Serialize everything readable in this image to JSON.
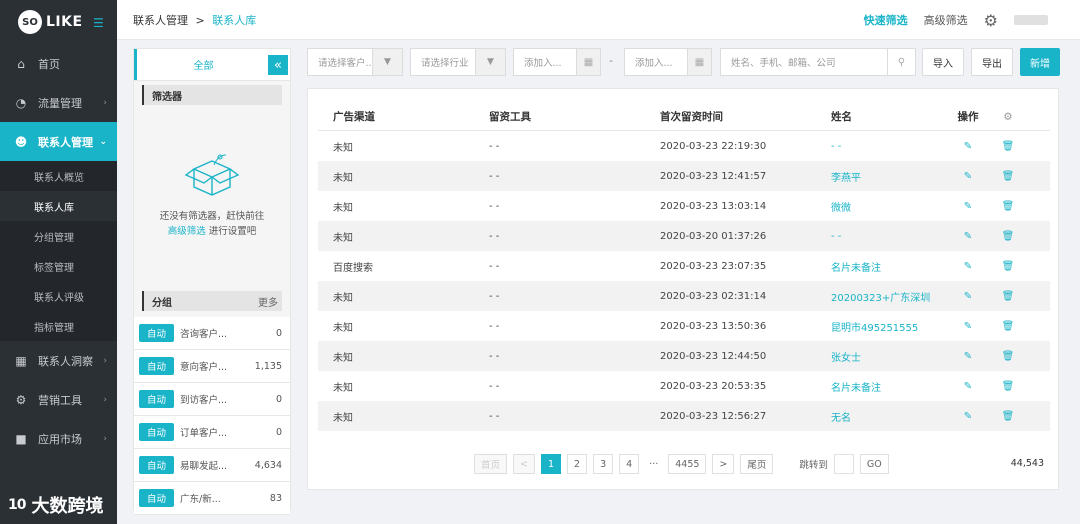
{
  "app": {
    "logo_circle": "SO",
    "logo_text": "LIKE"
  },
  "sidebar": {
    "items": [
      {
        "label": "首页",
        "icon": "home-icon"
      },
      {
        "label": "流量管理",
        "icon": "pie-chart-icon"
      },
      {
        "label": "联系人管理",
        "icon": "users-icon"
      },
      {
        "label": "联系人洞察",
        "icon": "id-card-icon"
      },
      {
        "label": "营销工具",
        "icon": "cogs-icon"
      },
      {
        "label": "应用市场",
        "icon": "briefcase-icon"
      }
    ],
    "sub_items": [
      {
        "label": "联系人概览"
      },
      {
        "label": "联系人库"
      },
      {
        "label": "分组管理"
      },
      {
        "label": "标签管理"
      },
      {
        "label": "联系人评级"
      },
      {
        "label": "指标管理"
      }
    ],
    "watermark": "大数跨境",
    "watermark_logo": "10"
  },
  "header": {
    "breadcrumb_parent": "联系人管理",
    "breadcrumb_sep": ">",
    "breadcrumb_current": "联系人库",
    "quick_filter": "快速筛选",
    "advanced_filter": "高级筛选"
  },
  "left_panel": {
    "all_label": "全部",
    "filter_title": "筛选器",
    "empty_line1": "还没有筛选器，赶快前往",
    "empty_link": "高级筛选",
    "empty_line2": "进行设置吧",
    "group_title": "分组",
    "group_more": "更多",
    "groups": [
      {
        "badge": "自动",
        "name": "咨询客户...",
        "count": "0"
      },
      {
        "badge": "自动",
        "name": "意向客户...",
        "count": "1,135"
      },
      {
        "badge": "自动",
        "name": "到访客户...",
        "count": "0"
      },
      {
        "badge": "自动",
        "name": "订单客户...",
        "count": "0"
      },
      {
        "badge": "自动",
        "name": "易聊发起...",
        "count": "4,634"
      },
      {
        "badge": "自动",
        "name": "广东/新...",
        "count": "83"
      }
    ]
  },
  "filters": {
    "customer_placeholder": "请选择客户...",
    "industry_placeholder": "请选择行业",
    "date_from_placeholder": "添加入...",
    "date_to_placeholder": "添加入...",
    "date_sep": "-",
    "search_placeholder": "姓名、手机、邮箱、公司",
    "import_label": "导入",
    "export_label": "导出",
    "new_label": "新增"
  },
  "table": {
    "headers": [
      "广告渠道",
      "留资工具",
      "首次留资时间",
      "姓名",
      "操作"
    ],
    "rows": [
      {
        "channel": "未知",
        "tool": "- -",
        "time": "2020-03-23 22:19:30",
        "name": "- -"
      },
      {
        "channel": "未知",
        "tool": "- -",
        "time": "2020-03-23 12:41:57",
        "name": "李燕平"
      },
      {
        "channel": "未知",
        "tool": "- -",
        "time": "2020-03-23 13:03:14",
        "name": "微微"
      },
      {
        "channel": "未知",
        "tool": "- -",
        "time": "2020-03-20 01:37:26",
        "name": "- -"
      },
      {
        "channel": "百度搜索",
        "tool": "- -",
        "time": "2020-03-23 23:07:35",
        "name": "名片未备注"
      },
      {
        "channel": "未知",
        "tool": "- -",
        "time": "2020-03-23 02:31:14",
        "name": "20200323+广东深圳"
      },
      {
        "channel": "未知",
        "tool": "- -",
        "time": "2020-03-23 13:50:36",
        "name": "昆明市495251555"
      },
      {
        "channel": "未知",
        "tool": "- -",
        "time": "2020-03-23 12:44:50",
        "name": "张女士"
      },
      {
        "channel": "未知",
        "tool": "- -",
        "time": "2020-03-23 20:53:35",
        "name": "名片未备注"
      },
      {
        "channel": "未知",
        "tool": "- -",
        "time": "2020-03-23 12:56:27",
        "name": "无名"
      }
    ]
  },
  "pagination": {
    "first": "首页",
    "prev": "<",
    "pages": [
      "1",
      "2",
      "3",
      "4"
    ],
    "ellipsis": "···",
    "last_page": "4455",
    "next": ">",
    "last": "尾页",
    "jump_label": "跳转到",
    "go": "GO",
    "total": "44,543"
  }
}
